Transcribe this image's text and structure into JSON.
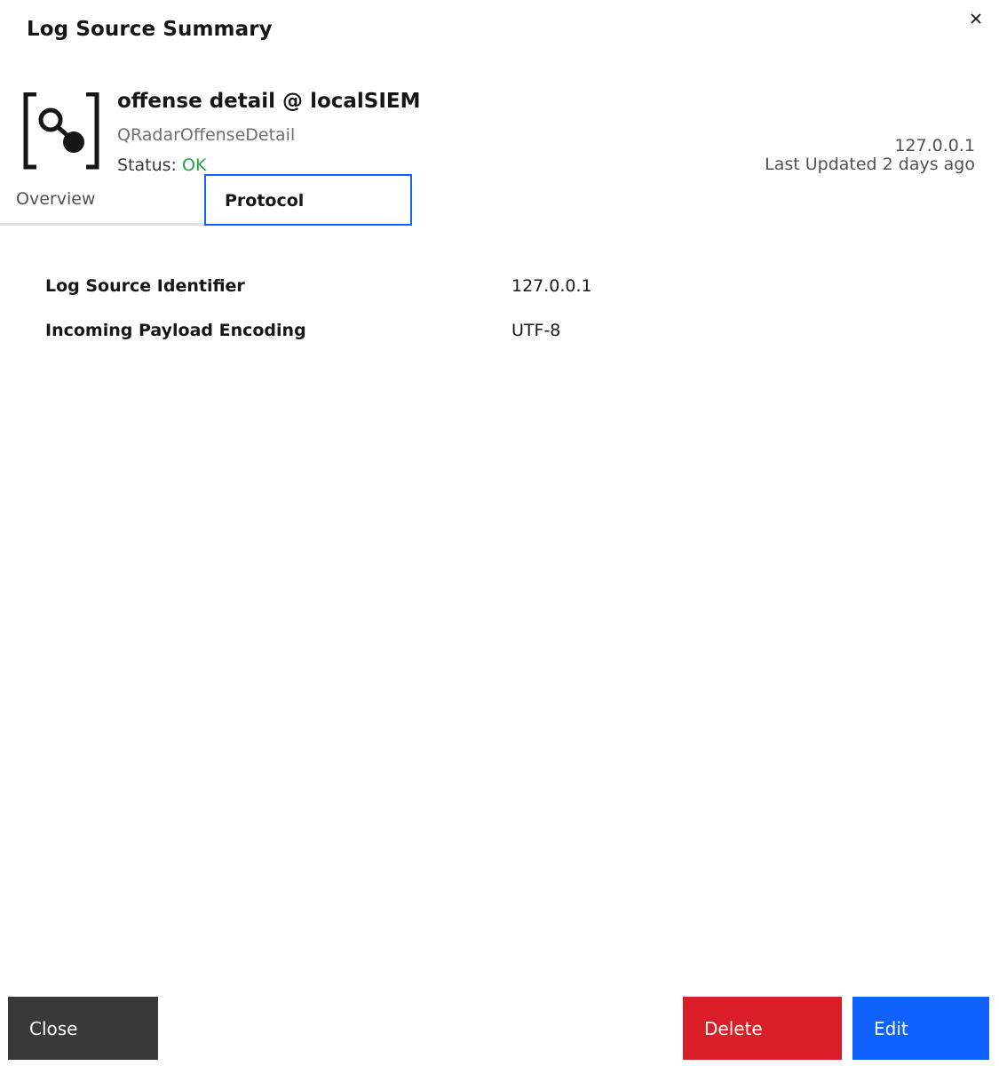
{
  "modal": {
    "title": "Log Source Summary"
  },
  "header": {
    "source_name": "offense detail @ localSIEM",
    "source_type": "QRadarOffenseDetail",
    "status_label": "Status:",
    "status_value": "OK",
    "status_color": "#24a148",
    "ip": "127.0.0.1",
    "last_updated": "Last Updated 2 days ago",
    "icon": "log-source-icon"
  },
  "tabs": [
    {
      "label": "Overview",
      "active": false
    },
    {
      "label": "Protocol",
      "active": true
    }
  ],
  "details": [
    {
      "label": "Log Source Identifier",
      "value": "127.0.0.1"
    },
    {
      "label": "Incoming Payload Encoding",
      "value": "UTF-8"
    }
  ],
  "footer": {
    "close_label": "Close",
    "delete_label": "Delete",
    "edit_label": "Edit"
  },
  "colors": {
    "close_button": "#393939",
    "delete_button": "#da1e28",
    "edit_button": "#0f62fe",
    "focus_outline": "#0f62fe"
  }
}
